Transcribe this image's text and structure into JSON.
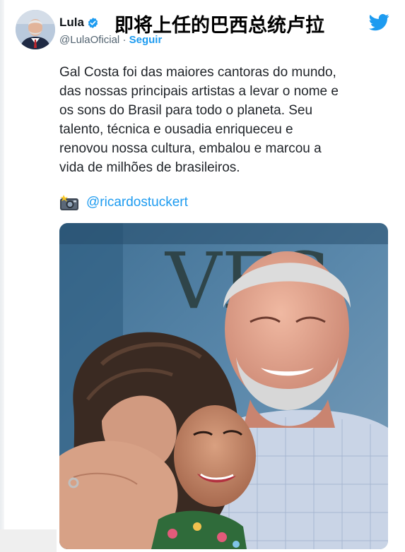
{
  "tweet": {
    "display_name": "Lula",
    "handle": "@LulaOficial",
    "separator": "·",
    "follow_label": "Seguir",
    "text_lines": [
      "Gal Costa foi das maiores cantoras do mundo,",
      "das nossas principais artistas a levar o nome e",
      "os sons do Brasil para todo o planeta. Seu",
      "talento, técnica e ousadia enriqueceu e",
      "renovou nossa cultura, embalou e marcou a",
      "vida de milhões de brasileiros."
    ],
    "photo_credit": "@ricardostuckert"
  },
  "overlay": {
    "caption": "即将上任的巴西总统卢拉"
  },
  "icons": {
    "verified": "verified-badge-icon",
    "brand": "twitter-bird-icon",
    "credit": "camera-flash-icon"
  },
  "colors": {
    "link_blue": "#1d9bf0",
    "text": "#1f2328",
    "secondary": "#536471"
  }
}
